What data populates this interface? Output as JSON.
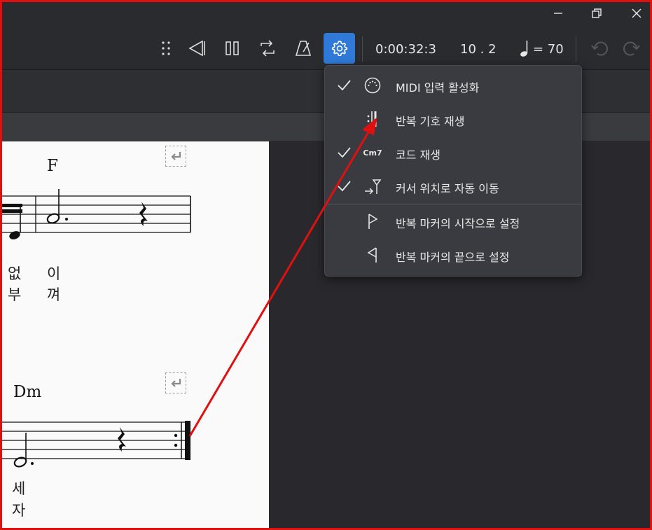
{
  "window": {
    "controls": {
      "minimize_icon": "minimize-icon",
      "restore_icon": "restore-icon",
      "close_icon": "close-icon"
    }
  },
  "toolbar": {
    "time": "0:00:32:3",
    "position": "10 . 2",
    "tempo_value": "= 70",
    "accent_color": "#2f7ad8"
  },
  "menu": {
    "items": [
      {
        "label": "MIDI 입력 활성화",
        "checked": true,
        "icon": "midi-port-icon"
      },
      {
        "label": "반복 기호 재생",
        "checked": false,
        "icon": "repeat-sign-icon"
      },
      {
        "label": "코드 재생",
        "checked": true,
        "icon": "chord-symbol-icon",
        "icon_text": "Cm7"
      },
      {
        "label": "커서 위치로 자동 이동",
        "checked": true,
        "icon": "pan-cursor-icon"
      },
      {
        "label": "반복 마커의 시작으로 설정",
        "checked": false,
        "icon": "flag-start-icon"
      },
      {
        "label": "반복 마커의 끝으로 설정",
        "checked": false,
        "icon": "flag-end-icon"
      }
    ]
  },
  "score": {
    "system1": {
      "chord": "F",
      "lyrics_line1": [
        "없",
        "이"
      ],
      "lyrics_line2": [
        "부",
        "껴"
      ]
    },
    "system2": {
      "chord": "Dm",
      "lyrics_line1": [
        "세"
      ],
      "lyrics_line2": [
        "자"
      ]
    }
  },
  "annotation": {
    "arrow_color": "#e01010",
    "border_color": "#e01010"
  }
}
